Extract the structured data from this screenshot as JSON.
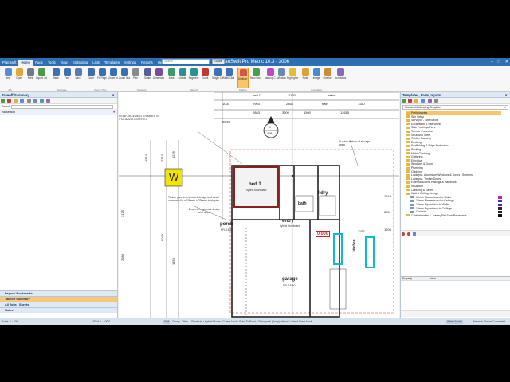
{
  "window": {
    "title": "PlanSwift Pro Metric 10.3 - 3006",
    "controls": [
      "–",
      "□",
      "✕"
    ]
  },
  "menu": {
    "items": [
      "PlanSwift",
      "Home",
      "Page",
      "Tools",
      "View",
      "Estimating",
      "Lists",
      "Templates",
      "Settings",
      "Reports",
      "Help",
      "Plugins"
    ],
    "active": "Home",
    "search_placeholder": "Search",
    "guide_label": "Guide"
  },
  "ribbon": {
    "buttons": [
      {
        "label": "New",
        "icon": "new-icon",
        "color": "#5b8dd6"
      },
      {
        "label": "Open",
        "icon": "open-folder-icon",
        "color": "#e0a83a"
      },
      {
        "label": "Print",
        "icon": "print-icon",
        "color": "#6d7a8a"
      },
      {
        "label": "Import Job",
        "icon": "import-icon",
        "color": "#4a9a4a"
      },
      {
        "label": "Back",
        "icon": "back-arrow-icon",
        "color": "#3f6fb5"
      },
      {
        "label": "Fwd",
        "icon": "forward-arrow-icon",
        "color": "#3f6fb5"
      },
      {
        "label": "Save",
        "icon": "save-icon",
        "color": "#5a7bb0"
      },
      {
        "label": "Zoom",
        "icon": "zoom-icon",
        "color": "#3a6fb0"
      },
      {
        "label": "Fit Page",
        "icon": "fit-page-icon",
        "color": "#3a6fb0"
      },
      {
        "label": "Zoom In",
        "icon": "zoom-in-icon",
        "color": "#3a6fb0"
      },
      {
        "label": "Zoom Out",
        "icon": "zoom-out-icon",
        "color": "#3a6fb0"
      },
      {
        "label": "Pan",
        "icon": "pan-icon",
        "color": "#8a8a8a"
      },
      {
        "label": "Scale",
        "icon": "scale-icon",
        "color": "#5b5b9b"
      },
      {
        "label": "Dimension",
        "icon": "dimension-icon",
        "color": "#7c4aa0"
      },
      {
        "label": "Area",
        "icon": "area-icon",
        "color": "#3a9a6a"
      },
      {
        "label": "Linear",
        "icon": "linear-icon",
        "color": "#2f8f8f"
      },
      {
        "label": "Segment",
        "icon": "segment-icon",
        "color": "#2f8f8f"
      },
      {
        "label": "Count",
        "icon": "count-icon",
        "color": "#c0392b"
      },
      {
        "label": "Single Click",
        "icon": "single-click-icon",
        "color": "#3f6fb5"
      },
      {
        "label": "Multi Click",
        "icon": "multi-click-icon",
        "color": "#3f6fb5"
      },
      {
        "label": "Digitizer Record",
        "icon": "record-icon",
        "color": "#d9534f"
      },
      {
        "label": "New Section",
        "icon": "new-section-icon",
        "color": "#4aa04a"
      },
      {
        "label": "Markup Color",
        "icon": "markup-color-icon",
        "color": "#c04ac0"
      },
      {
        "label": "Window",
        "icon": "window-icon",
        "color": "#6a8ab0"
      },
      {
        "label": "Highlighter",
        "icon": "highlighter-icon",
        "color": "#e0c030"
      },
      {
        "label": "Note",
        "icon": "note-icon",
        "color": "#e0a030"
      },
      {
        "label": "Image",
        "icon": "image-icon",
        "color": "#4a8ad0"
      },
      {
        "label": "Overlay",
        "icon": "overlay-icon",
        "color": "#d08a30"
      },
      {
        "label": "Annotations",
        "icon": "annotations-icon",
        "color": "#8a6ab0"
      }
    ],
    "highlighted": "Digitizer Record",
    "groups": [
      "Job",
      "Navigate",
      "Zoom / Pan",
      "Measure",
      "Takeoff",
      "Digitize",
      "Annotation"
    ]
  },
  "left_panel": {
    "title": "Takeoff Summary",
    "search_label": "Search",
    "selected_row": "eal section",
    "sections": [
      "Pages / Bookmarks",
      "Takeoff Summary",
      "All Jobs / Sheets",
      "Notes"
    ],
    "selected_section": "Takeoff Summary"
  },
  "drawing": {
    "rooms": [
      {
        "name": "bed 1",
        "note": "hybrid floorboard"
      },
      {
        "name": "l'dry",
        "note": ""
      },
      {
        "name": "bath",
        "note": ""
      },
      {
        "name": "entry",
        "note": "hybrid floorboard"
      },
      {
        "name": "porch",
        "note": "FFL 16.80"
      },
      {
        "name": "kitchen",
        "note": ""
      },
      {
        "name": "garage",
        "note": "FFL 16.80"
      }
    ],
    "notes": [
      "Timber post to engineers design and detail",
      "Timber post to engineers design and detail concealed in a 230mm x 230mm brick pier",
      "Beam to engineers design and detail",
      "6 cubic metres of storage area"
    ],
    "dimensions": [
      "1000",
      "2963",
      "1320",
      "2863",
      "2863",
      "1150",
      "1500",
      "3900",
      "12615",
      "4910",
      "2210",
      "6040",
      "1950",
      "1225",
      "2980",
      "3125",
      "605",
      "1610",
      "1205",
      "1152",
      "0.000"
    ],
    "section_tag": {
      "number": "1",
      "ref": "A08"
    },
    "count_marker": "W",
    "top_labels": [
      "bed 1",
      "stairs",
      "bath",
      "porch"
    ],
    "side_note": "REINFORCEMENT TRIMMED IN STANDARD PATTERN"
  },
  "right_panel": {
    "title": "Templates, Parts, Inputs",
    "dropdown": "Classical Estimating Template",
    "tree": [
      "Preliminaries",
      "Site Setup",
      "Surveyor - Site Setout",
      "Excavation & Site Works",
      "Slab Footings/Piers",
      "Termite Protection",
      "Structural Steel",
      "Timber Framing",
      "Decking",
      "Scaffolding & Edge Protection",
      "Roofing",
      "Metal Cladding",
      "Guttering",
      "Electrical",
      "Windows & Doors",
      "Plumbing",
      "Cladding",
      "Lockups - Aluminium Windows & Doors / Screens",
      "Lockups - Timber Doors",
      "External Doors, Railings & Handrails",
      "Insulation",
      "Cladding & Eaves",
      "Wall & Ceiling Linings",
      "10mm Plasterboard to Walls",
      "10mm Plasterboard to Ceilings",
      "10mm Aquacheck to Walls",
      "10mm Aquacheck to Ceilings",
      "Cornice",
      "Cabinetmaker & Joinery/Rel Stair Balustrade"
    ],
    "swatches": [
      "#d020a0",
      "#2040d0",
      "#6020a0",
      "#2a2a2a",
      "#202020",
      "#101010"
    ],
    "properties_headers": [
      "Property",
      "Value"
    ]
  },
  "status": {
    "scale": "Scale: 1 : 100",
    "page": "100 %  1 : 100.0",
    "modes": [
      "Grid",
      "Osnap",
      "Ortho",
      "Snap"
    ],
    "hints": "Shortcuts  • Hybrid Floors  • Cursor Mode: Point To Point  • Orthogonal (Snap): takeoff  • Stand Alone Mode",
    "right_button": "Admin Mode",
    "right_text": "Network Status: Connected"
  },
  "colors": {
    "titlebar": "#2d6fb0",
    "highlight": "#f8c56a",
    "walls": "#8b2020",
    "marker": "#f5e400",
    "panel_header": "#dfe9f5"
  }
}
